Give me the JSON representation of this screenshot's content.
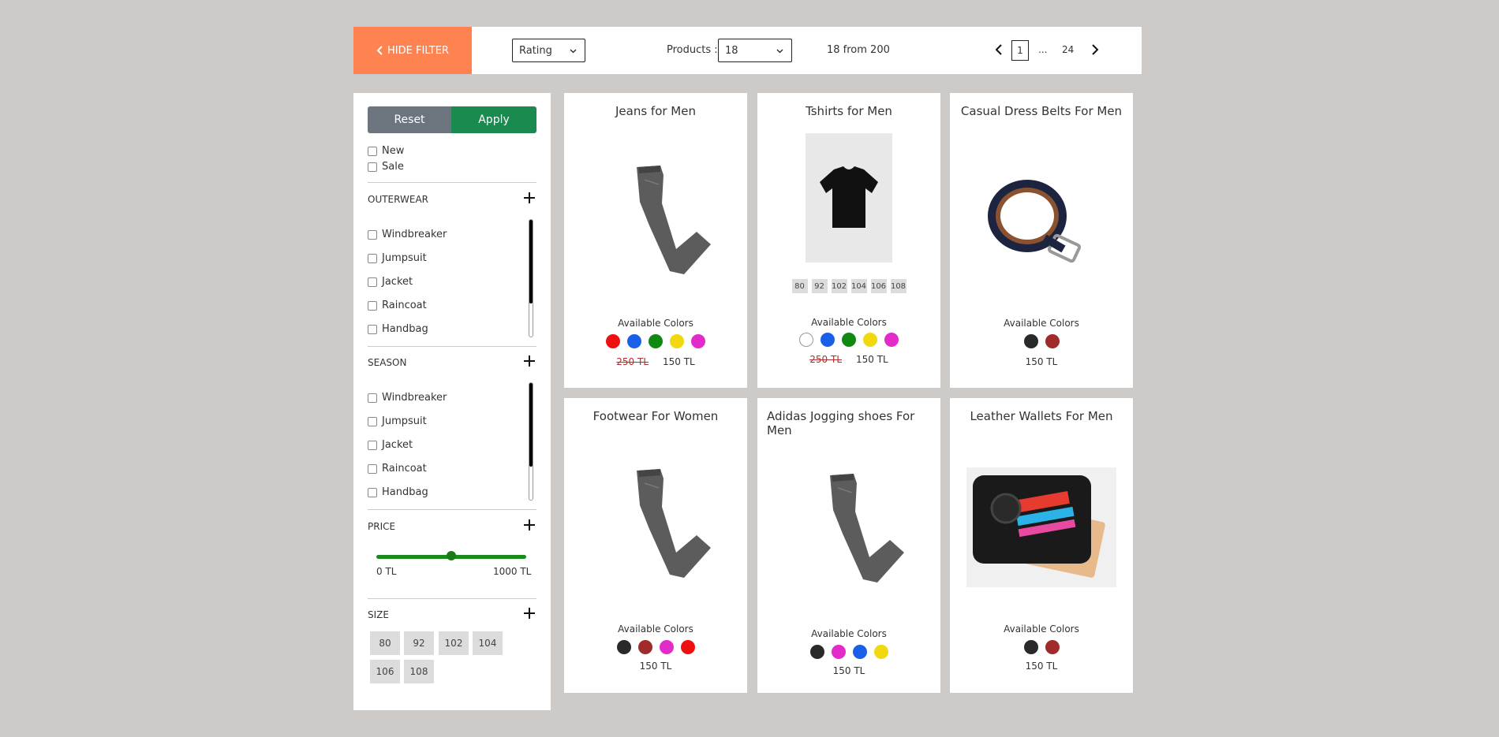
{
  "topbar": {
    "hide_filter_label": "HIDE FILTER",
    "sort_value": "Rating",
    "products_label": "Products :",
    "products_per_page": "18",
    "count_text": "18 from 200",
    "pager": {
      "current": "1",
      "ellipsis": "...",
      "last": "24"
    }
  },
  "filters": {
    "reset_label": "Reset",
    "apply_label": "Apply",
    "flags": [
      "New",
      "Sale"
    ],
    "outerwear": {
      "title": "OUTERWEAR",
      "items": [
        "Windbreaker",
        "Jumpsuit",
        "Jacket",
        "Raincoat",
        "Handbag"
      ]
    },
    "season": {
      "title": "SEASON",
      "items": [
        "Windbreaker",
        "Jumpsuit",
        "Jacket",
        "Raincoat",
        "Handbag"
      ]
    },
    "price": {
      "title": "PRICE",
      "min_label": "0 TL",
      "max_label": "1000 TL",
      "value_fraction": 0.5
    },
    "size": {
      "title": "SIZE",
      "options": [
        "80",
        "92",
        "102",
        "104",
        "106",
        "108"
      ]
    }
  },
  "colors": {
    "accent": "#ff8350",
    "apply": "#1b8a4f",
    "reset": "#6c757d"
  },
  "products": [
    {
      "title": "Jeans for Men",
      "image": "gray-jeans-image",
      "available_label": "Available Colors",
      "colors": [
        "#ee1111",
        "#1a5fe8",
        "#118811",
        "#f2d80f",
        "#e22bc8"
      ],
      "old_price": "250 TL",
      "price": "150 TL"
    },
    {
      "title": "Tshirts for Men",
      "image": "black-tshirt-image",
      "sizes": [
        "80",
        "92",
        "102",
        "104",
        "106",
        "108"
      ],
      "available_label": "Available Colors",
      "colors": [
        "#ffffff",
        "#1a5fe8",
        "#118811",
        "#f2d80f",
        "#e22bc8"
      ],
      "old_price": "250 TL",
      "price": "150 TL"
    },
    {
      "title": "Casual Dress Belts For Men",
      "image": "belt-image",
      "available_label": "Available Colors",
      "colors": [
        "#2a2a2a",
        "#a12a2a"
      ],
      "price": "150 TL"
    },
    {
      "title": "Footwear For Women",
      "image": "gray-jeans-image",
      "available_label": "Available Colors",
      "colors": [
        "#2a2a2a",
        "#a12a2a",
        "#e22bc8",
        "#ee1111"
      ],
      "price": "150 TL"
    },
    {
      "title": "Adidas Jogging shoes For Men",
      "image": "gray-jeans-image",
      "available_label": "Available Colors",
      "colors": [
        "#2a2a2a",
        "#e22bc8",
        "#1a5fe8",
        "#f2d80f"
      ],
      "price": "150 TL"
    },
    {
      "title": "Leather Wallets For Men",
      "image": "wallet-image",
      "available_label": "Available Colors",
      "colors": [
        "#2a2a2a",
        "#a12a2a"
      ],
      "price": "150 TL"
    }
  ]
}
